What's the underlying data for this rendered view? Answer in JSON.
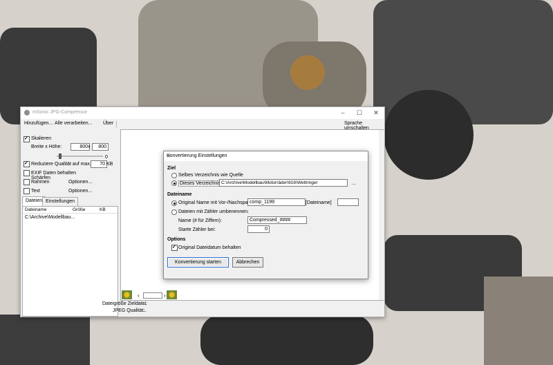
{
  "app": {
    "title": "mSonic JPG-Compressor",
    "menu": {
      "add": "Hinzufügen...",
      "process_all": "Alle verarbeiten...",
      "about": "Über",
      "language": "Sprache umschalten"
    },
    "left": {
      "scale_label": "Skalieren",
      "size_label": "Breite x Höhe:",
      "width": "800",
      "x": "x",
      "height": "800",
      "sharpen_label": "Schärfen",
      "sharpen_value": "0",
      "reduce_label": "Reduziere Qualität auf max.",
      "reduce_value": "70",
      "reduce_unit": "KB",
      "exif_label": "EXIF Daten behalten",
      "frame_label": "Rahmen",
      "frame_options": "Optionen...",
      "text_label": "Text",
      "text_options": "Optionen...",
      "scale_checked": true,
      "reduce_checked": true,
      "exif_checked": false,
      "frame_checked": false,
      "text_checked": false
    },
    "tabs": [
      "Dateien",
      "Einstellungen"
    ],
    "file_list": {
      "columns": [
        "Dateiname",
        "Größe",
        "KB"
      ],
      "rows": [
        "C:\\Archive\\Modellbau..."
      ]
    },
    "status": {
      "target_size_label": "Dateigröße Zieldatei:",
      "target_size_value": "...",
      "jpeg_quality_label": "JPEG Qualität:",
      "jpeg_quality_value": "..."
    }
  },
  "dialog": {
    "title": "Konvertierung Einstellungen",
    "close": "✕",
    "target": {
      "heading": "Ziel",
      "same_dir": "Selbes Verzeichnis wie Quelle",
      "this_dir": "Dieses Verzeichnis:",
      "dir_value": "C:\\Archive\\Modellbau\\Motorräder\\916\\Wettringer",
      "browse": "..."
    },
    "filename": {
      "heading": "Dateiname",
      "original": "Original Name mit Vor-/Nachspann:",
      "prefix": "comp_1199",
      "name_token": "[Dateiname]",
      "suffix": "",
      "counter": "Dateien mit Zähler umbenennen:",
      "name_label": "Name (# für Ziffern):",
      "name_value": "Compressed_####",
      "start_label": "Starte Zähler bei:",
      "start_value": "0"
    },
    "options": {
      "heading": "Options",
      "keep_date": "Original Dateidatum behalten",
      "keep_date_checked": true
    },
    "buttons": {
      "start": "Konvertierung starten",
      "cancel": "Abbrechen"
    }
  }
}
